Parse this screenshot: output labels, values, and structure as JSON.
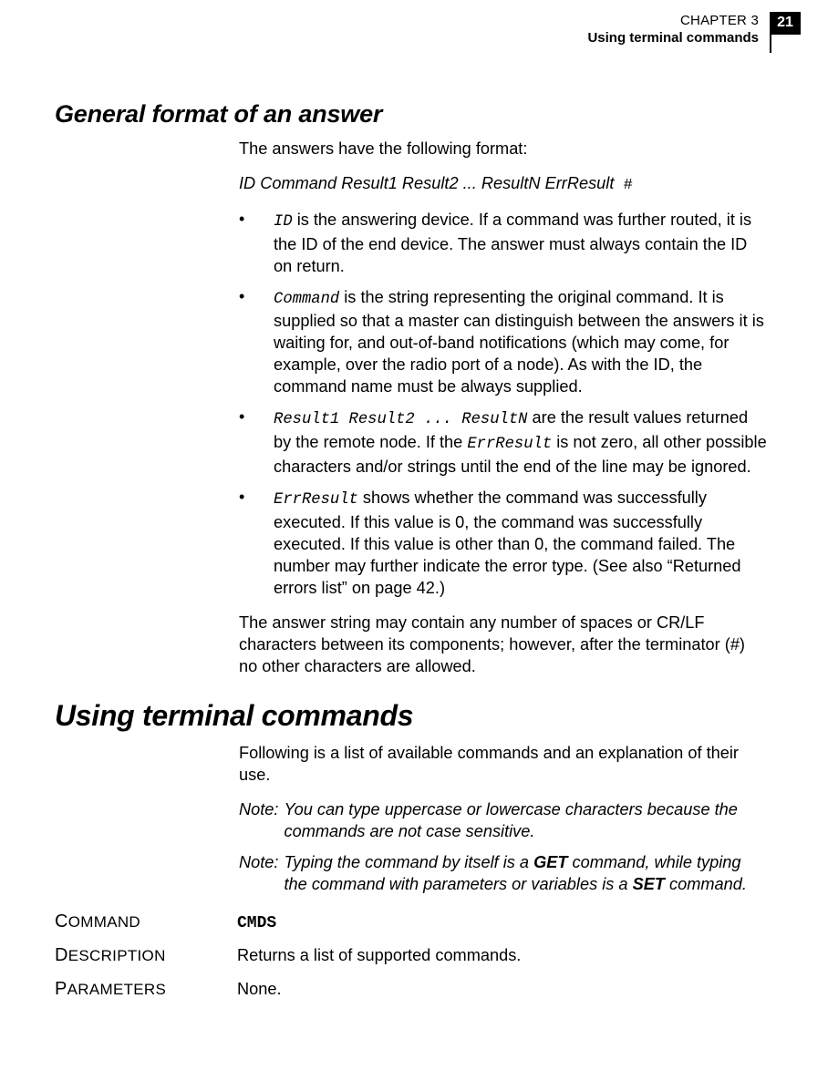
{
  "header": {
    "chapter": "CHAPTER 3",
    "subtitle": "Using terminal commands",
    "page_number": "21"
  },
  "section1": {
    "title": "General format of an answer",
    "intro": "The answers have the following format:",
    "format_italic": "ID Command Result1 Result2 ... ResultN ErrResult",
    "format_hash": " #",
    "bullets": {
      "b1_code": "ID",
      "b1_rest": " is the answering device. If a command was further routed, it is the ID of the end device. The answer must always contain the ID on return.",
      "b2_code": "Command",
      "b2_rest": " is the string representing the original command. It is supplied so that a master can distinguish between the answers it is waiting for, and out-of-band notifications (which may come, for example, over the radio port of a node). As with the ID, the command name must be always supplied.",
      "b3_code": "Result1 Result2 ... ResultN",
      "b3_rest_a": " are the result values returned by the remote node. If the ",
      "b3_code2": "ErrResult",
      "b3_rest_b": " is not zero, all other possible characters and/or strings until the end of the line may be ignored.",
      "b4_code": "ErrResult",
      "b4_rest": " shows whether the command was successfully executed. If this value is 0, the command was successfully executed. If this value is other than 0, the command failed. The number may further indicate the error type. (See also “Returned errors list” on page 42.)"
    },
    "outro": "The answer string may contain any number of spaces or CR/LF characters between its components; however, after the terminator (#) no other characters are allowed."
  },
  "section2": {
    "title": "Using terminal commands",
    "intro": "Following is a list of available commands and an explanation of their use.",
    "note1_label": "Note: ",
    "note1_body": "You can type uppercase or lowercase characters because the commands are not case sensitive.",
    "note2_label": "Note: ",
    "note2_body_a": "Typing the command by itself is a ",
    "note2_bold1": "GET",
    "note2_body_b": " command, while typing the command with parameters or variables is a ",
    "note2_bold2": "SET",
    "note2_body_c": " command."
  },
  "defs": {
    "command_label_first": "C",
    "command_label_rest": "OMMAND",
    "command_value": "CMDS",
    "desc_label_first": "D",
    "desc_label_rest": "ESCRIPTION",
    "desc_value": "Returns a list of supported commands.",
    "params_label_first": "P",
    "params_label_rest": "ARAMETERS",
    "params_value": "None."
  }
}
